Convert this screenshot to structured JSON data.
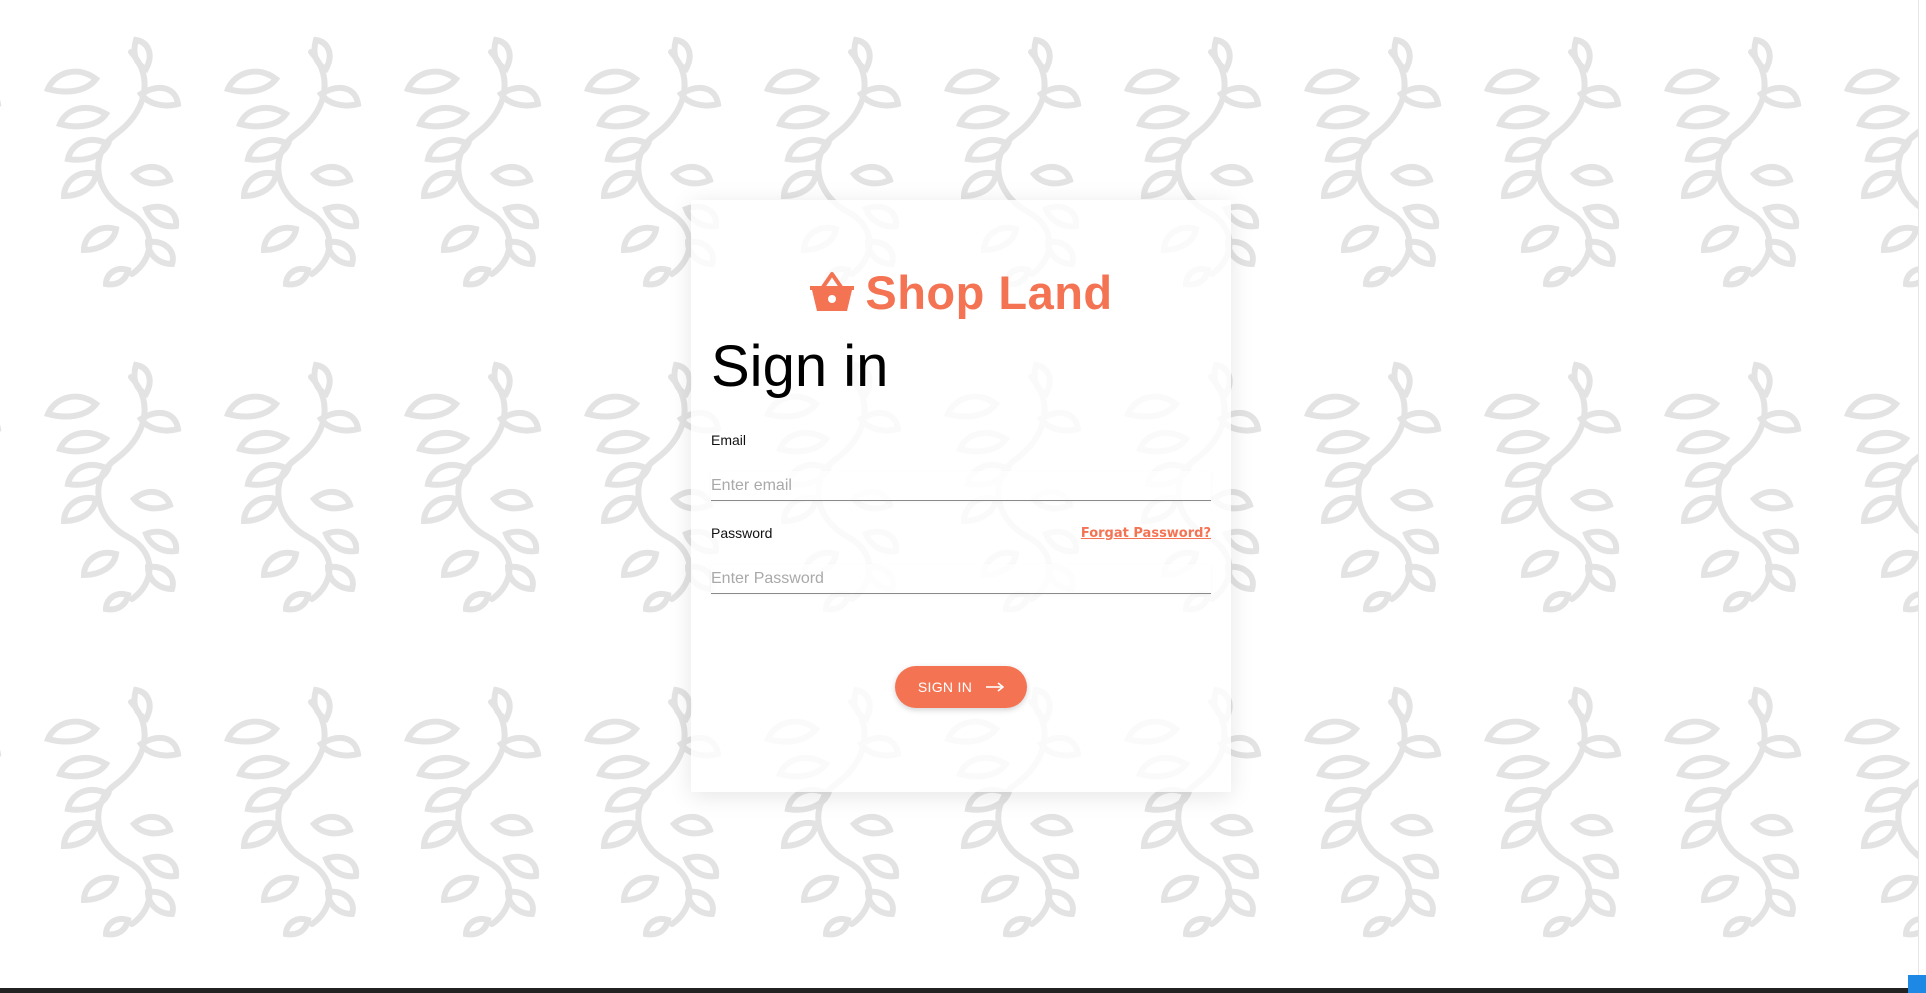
{
  "brand": {
    "name": "Shop Land",
    "icon": "shopping-basket-icon",
    "color": "#f47353"
  },
  "form": {
    "title": "Sign in",
    "email_label": "Email",
    "email_placeholder": "Enter email",
    "email_value": "",
    "password_label": "Password",
    "password_placeholder": "Enter Password",
    "password_value": "",
    "forgot_link": "Forgat Password?",
    "submit_label": "SIGN IN",
    "submit_icon": "arrow-right-icon"
  },
  "background": {
    "pattern": "leaf-vine-pattern",
    "pattern_color": "#e3e3e3"
  }
}
